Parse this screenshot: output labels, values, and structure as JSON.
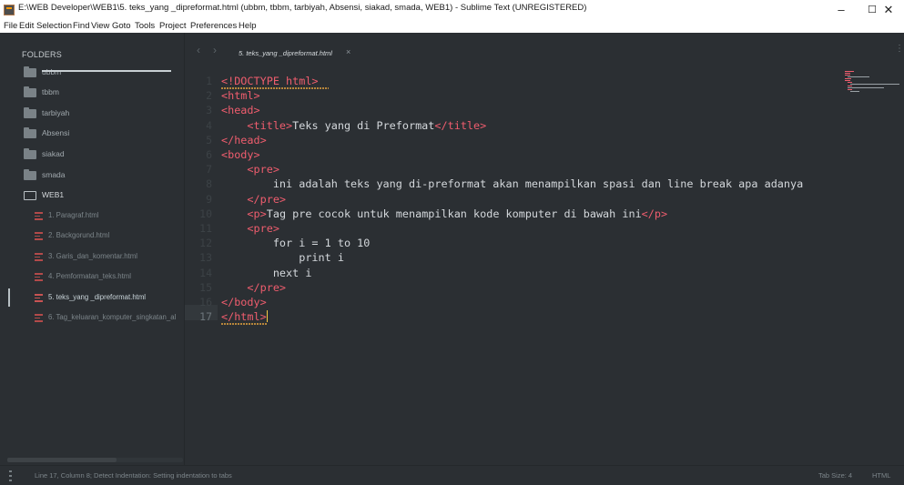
{
  "window": {
    "title": "E:\\WEB Developer\\WEB1\\5. teks_yang _dipreformat.html (ubbm, tbbm, tarbiyah, Absensi, siakad, smada, WEB1) - Sublime Text (UNREGISTERED)",
    "minimize": "–",
    "maximize": "☐",
    "close": "✕"
  },
  "menu": [
    "File",
    "Edit",
    "Selection",
    "Find",
    "View",
    "Goto",
    "Tools",
    "Project",
    "Preferences",
    "Help"
  ],
  "sidebar": {
    "header": "FOLDERS",
    "folders": [
      "ubbm",
      "tbbm",
      "tarbiyah",
      "Absensi",
      "siakad",
      "smada",
      "WEB1"
    ],
    "files": [
      "1. Paragraf.html",
      "2. Backgorund.html",
      "3. Garis_dan_komentar.html",
      "4. Pemformatan_teks.html",
      "5. teks_yang _dipreformat.html",
      "6. Tag_keluaran_komputer_singkatan_al"
    ],
    "active_file_index": 4
  },
  "tabs": {
    "prev": "‹",
    "next": "›",
    "active_label": "5. teks_yang _dipreformat.html",
    "close": "×",
    "more": "⋮"
  },
  "editor": {
    "line_numbers": [
      "1",
      "2",
      "3",
      "4",
      "5",
      "6",
      "7",
      "8",
      "9",
      "10",
      "11",
      "12",
      "13",
      "14",
      "15",
      "16",
      "17"
    ],
    "current_line": 17,
    "lines": [
      [
        [
          "tag",
          "<!DOCTYPE html>"
        ]
      ],
      [
        [
          "tag",
          "<html>"
        ]
      ],
      [
        [
          "tag",
          "<head>"
        ]
      ],
      [
        [
          "txt",
          "    "
        ],
        [
          "tag",
          "<title>"
        ],
        [
          "txt",
          "Teks yang di Preformat"
        ],
        [
          "tag",
          "</title>"
        ]
      ],
      [
        [
          "tag",
          "</head>"
        ]
      ],
      [
        [
          "tag",
          "<body>"
        ]
      ],
      [
        [
          "txt",
          "    "
        ],
        [
          "tag",
          "<pre>"
        ]
      ],
      [
        [
          "txt",
          "        ini adalah teks yang di-preformat akan menampilkan spasi dan line break apa adanya"
        ]
      ],
      [
        [
          "txt",
          "    "
        ],
        [
          "tag",
          "</pre>"
        ]
      ],
      [
        [
          "txt",
          "    "
        ],
        [
          "tag",
          "<p>"
        ],
        [
          "txt",
          "Tag pre cocok untuk menampilkan kode komputer di bawah ini"
        ],
        [
          "tag",
          "</p>"
        ]
      ],
      [
        [
          "txt",
          "    "
        ],
        [
          "tag",
          "<pre>"
        ]
      ],
      [
        [
          "txt",
          "        for i = 1 to 10"
        ]
      ],
      [
        [
          "txt",
          "            print i"
        ]
      ],
      [
        [
          "txt",
          "        next i"
        ]
      ],
      [
        [
          "txt",
          "    "
        ],
        [
          "tag",
          "</pre>"
        ]
      ],
      [
        [
          "tag",
          "</body>"
        ]
      ],
      [
        [
          "tag",
          "</html>"
        ]
      ]
    ]
  },
  "status": {
    "message": "Line 17, Column 8; Detect Indentation: Setting indentation to tabs",
    "tab_size": "Tab Size: 4",
    "syntax": "HTML"
  },
  "colors": {
    "background": "#2b2f33",
    "tag": "#ef5d6e",
    "text": "#d4d8dc",
    "caret": "#f5c842"
  }
}
